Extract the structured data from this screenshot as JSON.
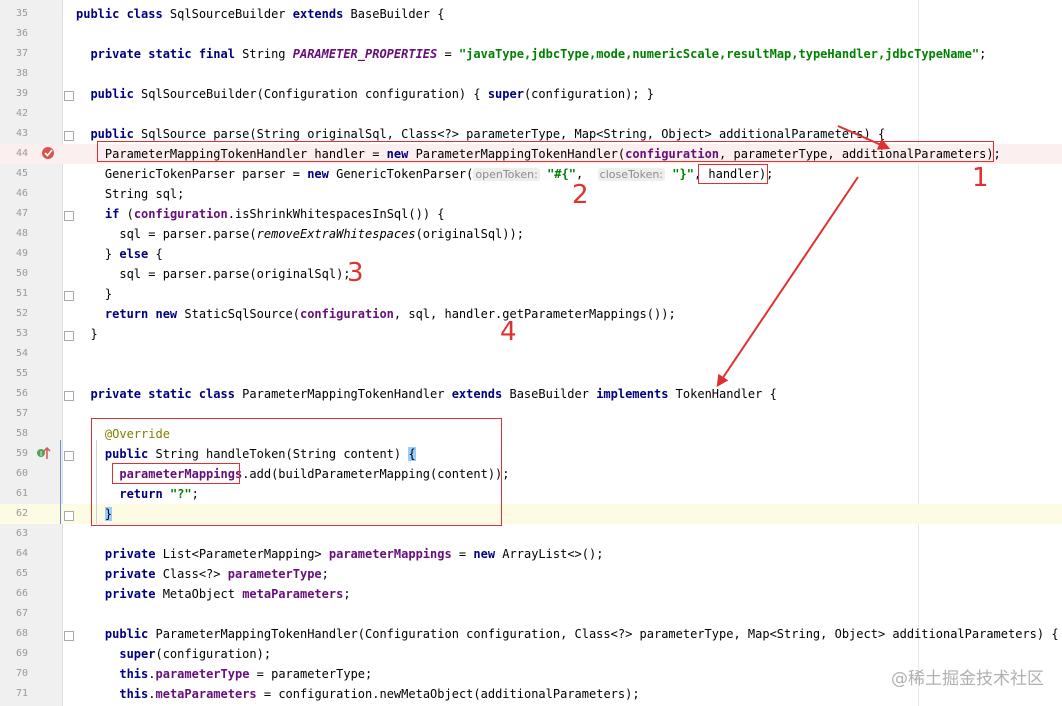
{
  "editor": {
    "line_numbers": [
      "35",
      "36",
      "37",
      "38",
      "39",
      "42",
      "43",
      "44",
      "45",
      "46",
      "47",
      "48",
      "49",
      "50",
      "51",
      "52",
      "53",
      "54",
      "55",
      "56",
      "57",
      "58",
      "59",
      "60",
      "61",
      "62",
      "63",
      "64",
      "65",
      "66",
      "67",
      "68",
      "69",
      "70",
      "71"
    ],
    "lines": [
      [
        [
          "kw",
          "public class "
        ],
        [
          "",
          "SqlSourceBuilder "
        ],
        [
          "kw",
          "extends "
        ],
        [
          "",
          "BaseBuilder {"
        ]
      ],
      [],
      [
        [
          "",
          "  "
        ],
        [
          "kw",
          "private static final "
        ],
        [
          "",
          "String "
        ],
        [
          "fldi",
          "PARAMETER_PROPERTIES"
        ],
        [
          "",
          " = "
        ],
        [
          "str",
          "\"javaType,jdbcType,mode,numericScale,resultMap,typeHandler,jdbcTypeName\""
        ],
        [
          "",
          ";"
        ]
      ],
      [],
      [
        [
          "",
          "  "
        ],
        [
          "kw",
          "public "
        ],
        [
          "",
          "SqlSourceBuilder(Configuration configuration) "
        ],
        [
          "",
          "{ "
        ],
        [
          "kw",
          "super"
        ],
        [
          "",
          "(configuration); }"
        ]
      ],
      [],
      [
        [
          "",
          "  "
        ],
        [
          "kw",
          "public "
        ],
        [
          "",
          "SqlSource parse(String originalSql, Class<?> parameterType, Map<String, Object> additionalParameters) {"
        ]
      ],
      [
        [
          "",
          "    ParameterMappingTokenHandler handler = "
        ],
        [
          "kw",
          "new "
        ],
        [
          "",
          "ParameterMappingTokenHandler("
        ],
        [
          "fld",
          "configuration"
        ],
        [
          "",
          ", parameterType, additionalParameters);"
        ]
      ],
      [
        [
          "",
          "    GenericTokenParser parser = "
        ],
        [
          "kw",
          "new "
        ],
        [
          "",
          "GenericTokenParser("
        ],
        [
          "hint",
          "openToken:"
        ],
        [
          "",
          " "
        ],
        [
          "str",
          "\"#{\""
        ],
        [
          "",
          ",  "
        ],
        [
          "hint",
          "closeToken:"
        ],
        [
          "",
          " "
        ],
        [
          "str",
          "\"}\""
        ],
        [
          "",
          ", handler);"
        ]
      ],
      [
        [
          "",
          "    String sql;"
        ]
      ],
      [
        [
          "",
          "    "
        ],
        [
          "kw",
          "if "
        ],
        [
          "",
          "("
        ],
        [
          "fld",
          "configuration"
        ],
        [
          "",
          ".isShrinkWhitespacesInSql()) {"
        ]
      ],
      [
        [
          "",
          "      sql = parser.parse("
        ],
        [
          "it",
          "removeExtraWhitespaces"
        ],
        [
          "",
          "(originalSql));"
        ]
      ],
      [
        [
          "",
          "    } "
        ],
        [
          "kw",
          "else "
        ],
        [
          "",
          "{"
        ]
      ],
      [
        [
          "",
          "      sql = parser.parse(originalSql);"
        ]
      ],
      [
        [
          "",
          "    }"
        ]
      ],
      [
        [
          "",
          "    "
        ],
        [
          "kw",
          "return new "
        ],
        [
          "",
          "StaticSqlSource("
        ],
        [
          "fld",
          "configuration"
        ],
        [
          "",
          ", sql, handler.getParameterMappings());"
        ]
      ],
      [
        [
          "",
          "  }"
        ]
      ],
      [],
      [],
      [
        [
          "",
          "  "
        ],
        [
          "kw",
          "private static class "
        ],
        [
          "",
          "ParameterMappingTokenHandler "
        ],
        [
          "kw",
          "extends "
        ],
        [
          "",
          "BaseBuilder "
        ],
        [
          "kw",
          "implements "
        ],
        [
          "",
          "TokenHandler {"
        ]
      ],
      [],
      [
        [
          "",
          "    "
        ],
        [
          "ann",
          "@Override"
        ]
      ],
      [
        [
          "",
          "    "
        ],
        [
          "kw",
          "public "
        ],
        [
          "",
          "String handleToken(String content) "
        ],
        [
          "brace",
          "{"
        ]
      ],
      [
        [
          "",
          "      "
        ],
        [
          "fld",
          "parameterMappings"
        ],
        [
          "",
          ".add(buildParameterMapping(content));"
        ]
      ],
      [
        [
          "",
          "      "
        ],
        [
          "kw",
          "return "
        ],
        [
          "str",
          "\"?\""
        ],
        [
          "",
          ";"
        ]
      ],
      [
        [
          "",
          "    "
        ],
        [
          "brace",
          "}"
        ]
      ],
      [],
      [
        [
          "",
          "    "
        ],
        [
          "kw",
          "private "
        ],
        [
          "",
          "List<ParameterMapping> "
        ],
        [
          "fld",
          "parameterMappings"
        ],
        [
          "",
          " = "
        ],
        [
          "kw",
          "new "
        ],
        [
          "",
          "ArrayList<>();"
        ]
      ],
      [
        [
          "",
          "    "
        ],
        [
          "kw",
          "private "
        ],
        [
          "",
          "Class<?> "
        ],
        [
          "fld",
          "parameterType"
        ],
        [
          "",
          ";"
        ]
      ],
      [
        [
          "",
          "    "
        ],
        [
          "kw",
          "private "
        ],
        [
          "",
          "MetaObject "
        ],
        [
          "fld",
          "metaParameters"
        ],
        [
          "",
          ";"
        ]
      ],
      [],
      [
        [
          "",
          "    "
        ],
        [
          "kw",
          "public "
        ],
        [
          "",
          "ParameterMappingTokenHandler(Configuration configuration, Class<?> parameterType, Map<String, Object> additionalParameters) {"
        ]
      ],
      [
        [
          "",
          "      "
        ],
        [
          "kw",
          "super"
        ],
        [
          "",
          "(configuration);"
        ]
      ],
      [
        [
          "",
          "      "
        ],
        [
          "kw",
          "this"
        ],
        [
          "",
          "."
        ],
        [
          "fld",
          "parameterType"
        ],
        [
          "",
          " = parameterType;"
        ]
      ],
      [
        [
          "",
          "      "
        ],
        [
          "kw",
          "this"
        ],
        [
          "",
          "."
        ],
        [
          "fld",
          "metaParameters"
        ],
        [
          "",
          " = configuration.newMetaObject(additionalParameters);"
        ]
      ]
    ]
  },
  "annotations": {
    "labels": [
      "1",
      "2",
      "3",
      "4"
    ],
    "color": "#e03030"
  },
  "watermark": "@稀土掘金技术社区",
  "colors": {
    "keyword": "#000080",
    "string": "#008000",
    "field": "#660e7a",
    "annotation": "#808000",
    "gutter_bg": "#f0f0f0",
    "current_line": "#fdfbe3",
    "breakpoint_line": "#fcefef"
  }
}
